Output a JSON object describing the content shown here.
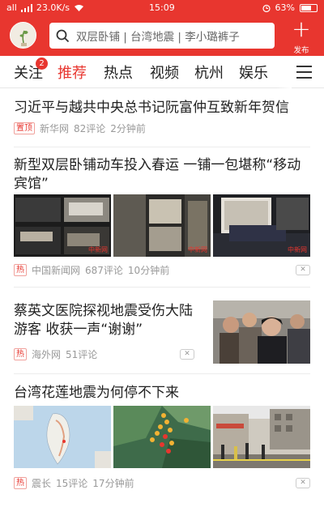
{
  "status_bar": {
    "signal": "all",
    "speed": "23.0K/s",
    "time": "15:09",
    "battery": "63%"
  },
  "header": {
    "search_placeholder": "双层卧铺 | 台湾地震 | 李小璐裤子",
    "publish_label": "发布"
  },
  "tabs": [
    {
      "label": "关注",
      "badge": "2",
      "active": false
    },
    {
      "label": "推荐",
      "active": true
    },
    {
      "label": "热点",
      "active": false
    },
    {
      "label": "视频",
      "active": false
    },
    {
      "label": "杭州",
      "active": false
    },
    {
      "label": "娱乐",
      "active": false
    }
  ],
  "articles": [
    {
      "title": "习近平与越共中央总书记阮富仲互致新年贺信",
      "tag": "置顶",
      "source": "新华网",
      "comments": "82评论",
      "time": "2分钟前"
    },
    {
      "title": "新型双层卧铺动车投入春运 一铺一包堪称“移动宾馆”",
      "tag": "热",
      "source": "中国新闻网",
      "comments": "687评论",
      "time": "10分钟前",
      "watermark": "中新网"
    },
    {
      "title": "蔡英文医院探视地震受伤大陆游客 收获一声“谢谢”",
      "tag": "热",
      "source": "海外网",
      "comments": "51评论"
    },
    {
      "title": "台湾花莲地震为何停不下来",
      "tag": "热",
      "source": "震长",
      "comments": "15评论",
      "time": "17分钟前"
    }
  ],
  "colors": {
    "brand_red": "#e8362f"
  }
}
